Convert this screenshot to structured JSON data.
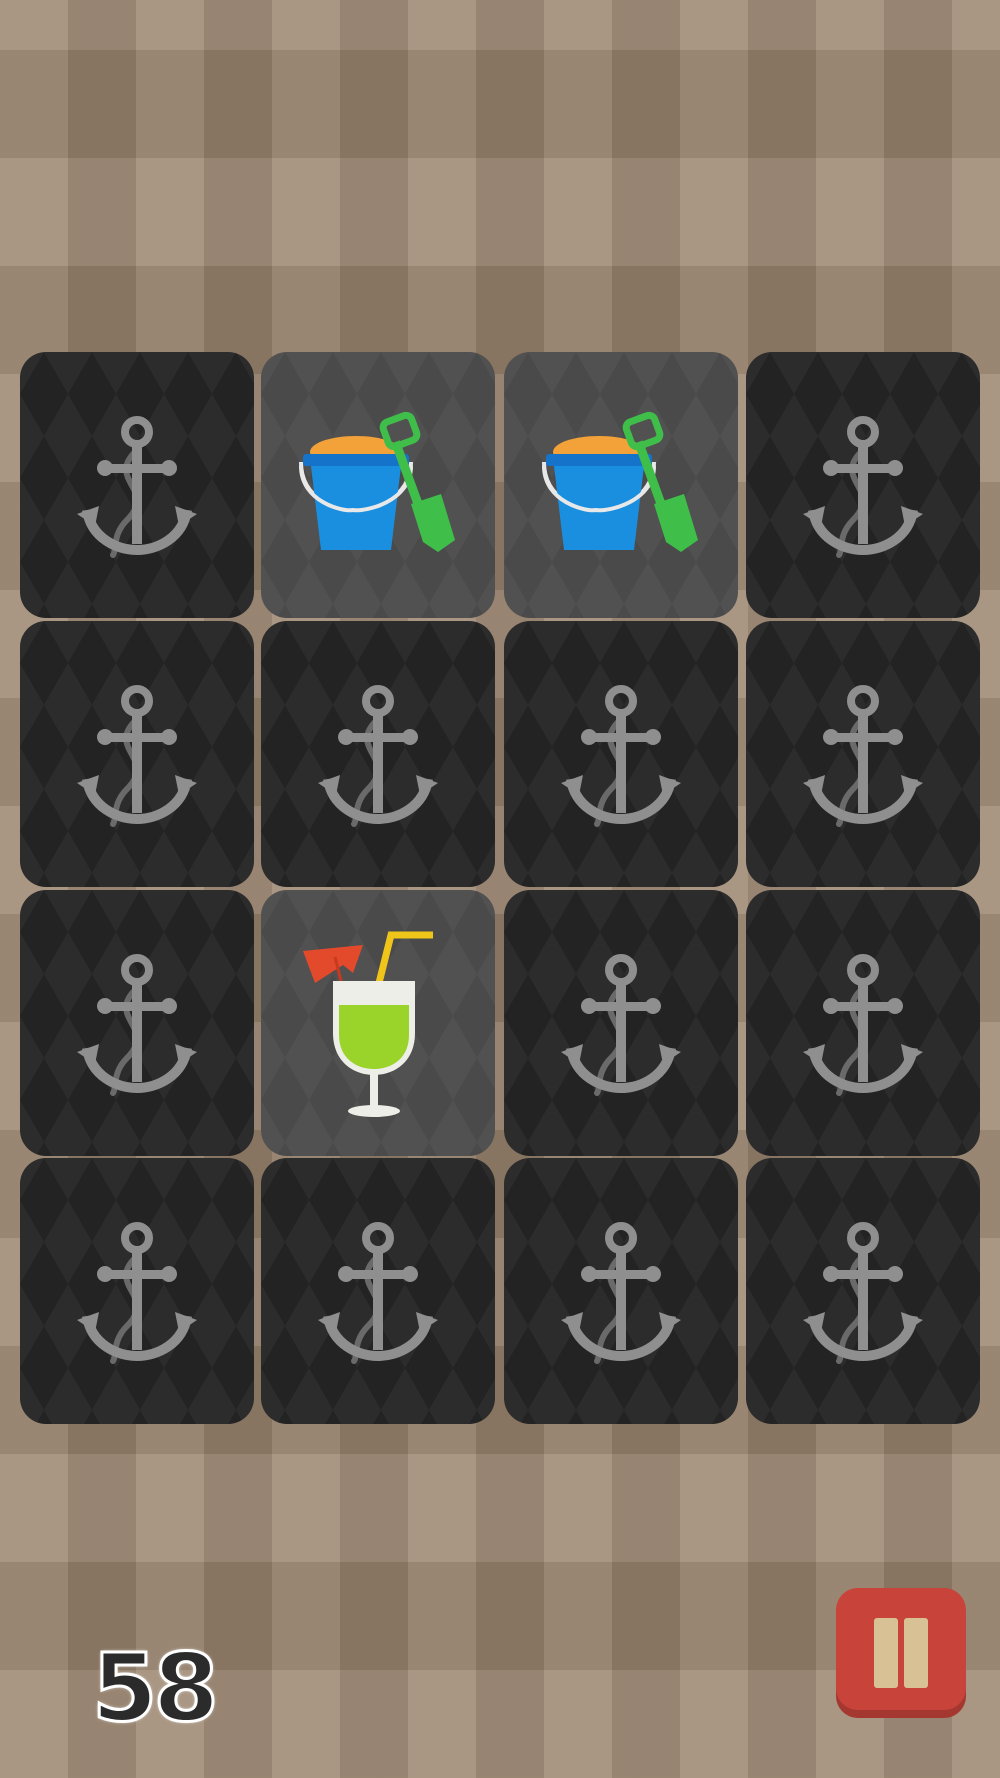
{
  "game": {
    "score": "58",
    "pause_label": "pause",
    "card_back_icon": "anchor-icon",
    "colors": {
      "card_back": "#232323",
      "card_face": "#4a4a4a",
      "anchor": "#8f8f8f",
      "pause_button": "#c8443a",
      "pause_bars": "#d9c196"
    }
  },
  "grid": {
    "rows": 4,
    "columns": 4,
    "cards": [
      {
        "state": "down",
        "icon": "anchor-icon"
      },
      {
        "state": "up",
        "icon": "sand-bucket-shovel-icon"
      },
      {
        "state": "up",
        "icon": "sand-bucket-shovel-icon"
      },
      {
        "state": "down",
        "icon": "anchor-icon"
      },
      {
        "state": "down",
        "icon": "anchor-icon"
      },
      {
        "state": "down",
        "icon": "anchor-icon"
      },
      {
        "state": "down",
        "icon": "anchor-icon"
      },
      {
        "state": "down",
        "icon": "anchor-icon"
      },
      {
        "state": "down",
        "icon": "anchor-icon"
      },
      {
        "state": "up",
        "icon": "cocktail-glass-icon"
      },
      {
        "state": "down",
        "icon": "anchor-icon"
      },
      {
        "state": "down",
        "icon": "anchor-icon"
      },
      {
        "state": "down",
        "icon": "anchor-icon"
      },
      {
        "state": "down",
        "icon": "anchor-icon"
      },
      {
        "state": "down",
        "icon": "anchor-icon"
      },
      {
        "state": "down",
        "icon": "anchor-icon"
      }
    ]
  }
}
